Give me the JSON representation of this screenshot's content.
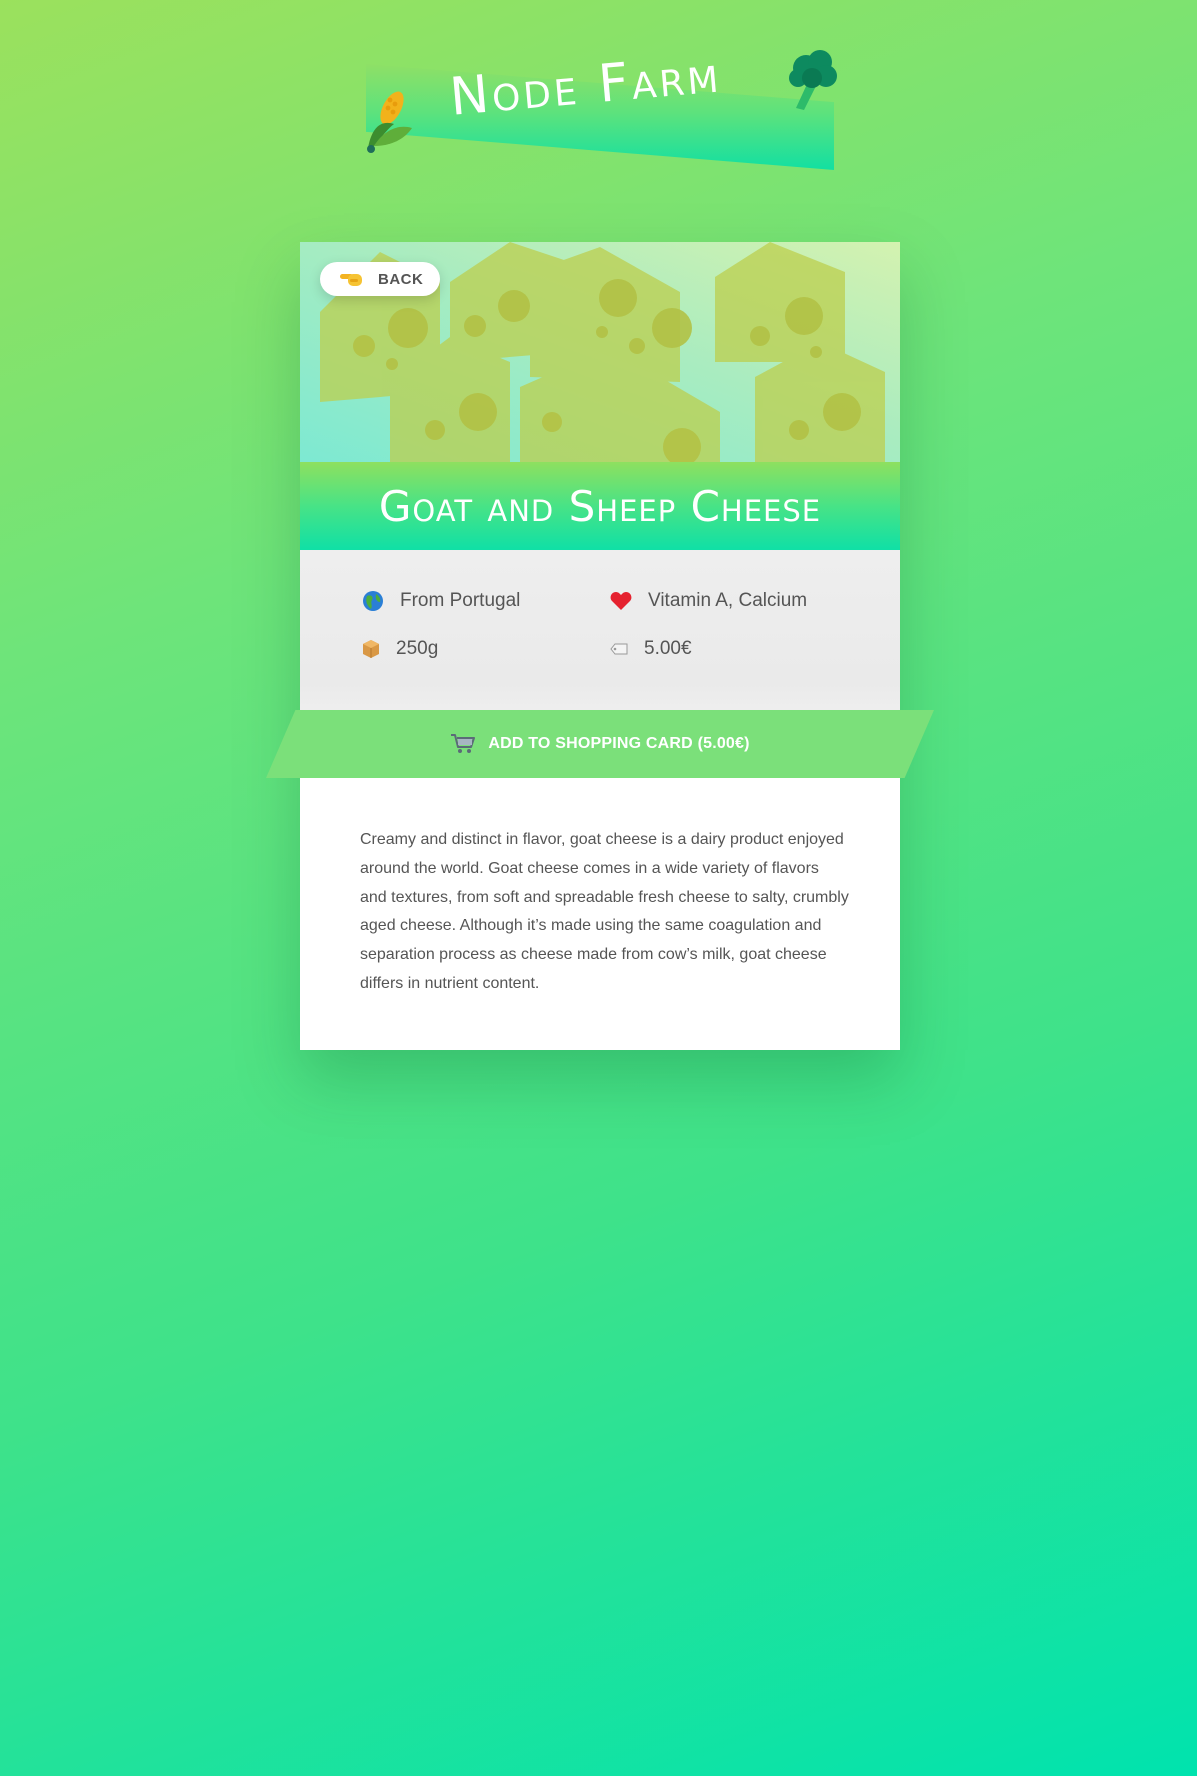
{
  "logo": {
    "title": "Node Farm",
    "left_icon": "corn-icon",
    "right_icon": "broccoli-icon"
  },
  "product": {
    "back_label": "BACK",
    "back_icon": "pointing-left-hand-icon",
    "hero_icon": "cheese-icon",
    "name": "Goat and Sheep Cheese",
    "origin": "From Portugal",
    "origin_icon": "globe-icon",
    "nutrients": "Vitamin A, Calcium",
    "nutrients_icon": "heart-icon",
    "quantity": "250g",
    "quantity_icon": "package-icon",
    "price": "5.00€",
    "price_icon": "price-tag-icon",
    "cart_label": "ADD TO SHOPPING CARD (5.00€)",
    "cart_icon": "shopping-cart-icon",
    "description": "Creamy and distinct in flavor, goat cheese is a dairy product enjoyed around the world. Goat cheese comes in a wide variety of flavors and textures, from soft and spreadable fresh cheese to salty, crumbly aged cheese. Although it’s made using the same coagulation and separation process as cheese made from cow’s milk, goat cheese differs in nutrient content."
  },
  "colors": {
    "background_start": "#9be15d",
    "background_end": "#00e3ae",
    "cart_button": "#7be07a",
    "text": "#555555"
  }
}
